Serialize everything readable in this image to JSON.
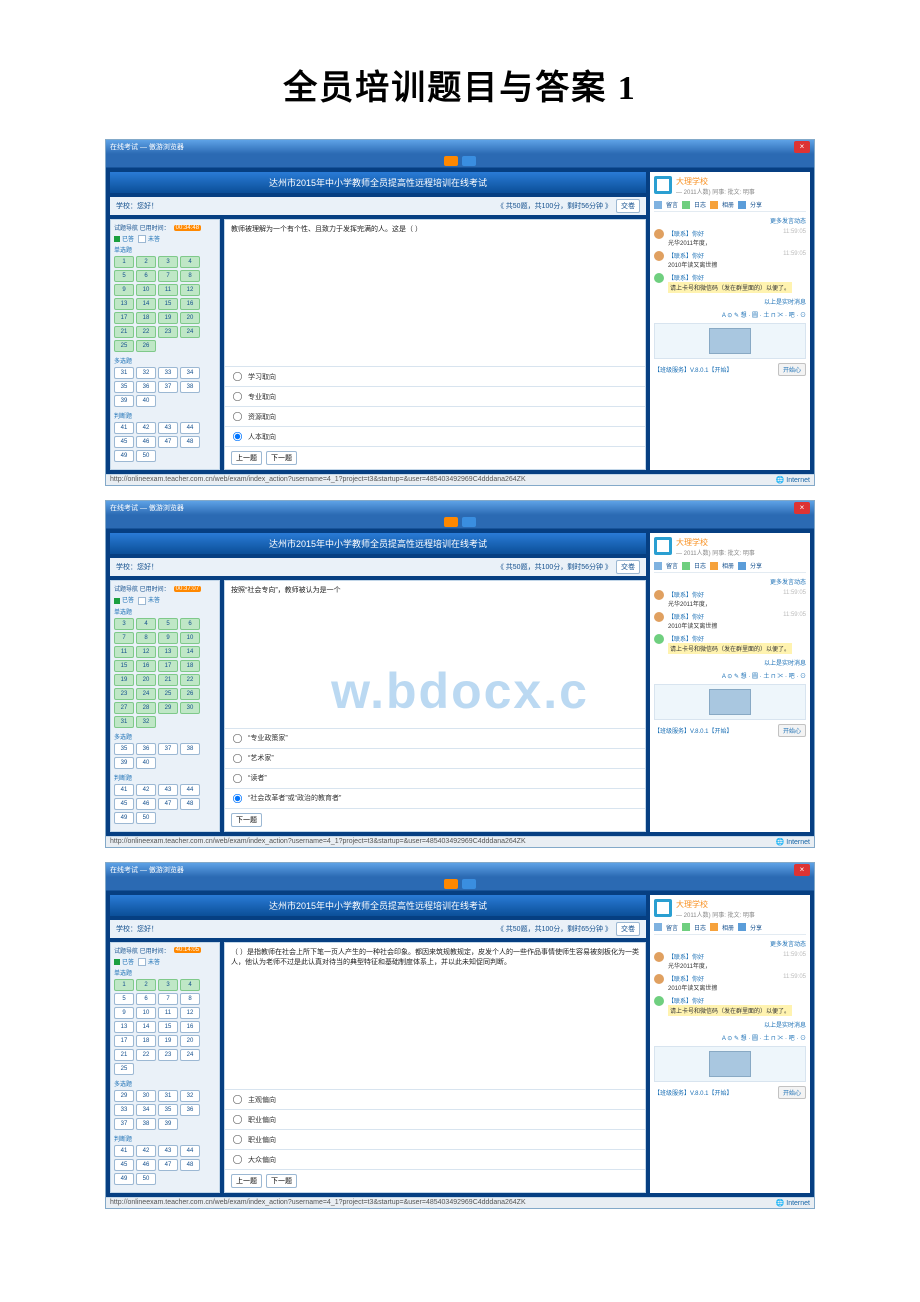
{
  "doc_title": "全员培训题目与答案 1",
  "watermark": "w.bdocx.c",
  "browser": {
    "title_prefix": "在线考试 — 傲游浏览器",
    "close": "×"
  },
  "statusbar": {
    "url": "http://onlineexam.teacher.com.cn/web/exam/index_action?username=4_1?project=t3&startup=&user=485403492969C4dddana264ZK",
    "inet": "Internet"
  },
  "right": {
    "school_name": "大理学校",
    "school_sub": "— 2011人数) 同事: 批文: 明事",
    "tabs": [
      "留言",
      "日志",
      "相册",
      "分享"
    ],
    "more_link": "更多发言动态",
    "feed": [
      {
        "user": "【联系】你好",
        "time": "11:59:05",
        "msg": "光华2011年度，"
      },
      {
        "user": "【联系】你好",
        "time": "11:59:05",
        "msg": "2010年读又离世擦"
      },
      {
        "user": "【联系】你好",
        "time": "",
        "msg_hl": "请上卡号和微信码（发在群里面的）以便了。"
      }
    ],
    "feed_more": "以上是实时消息",
    "footer_left": "【班级服务】V.8.0.1【开始】",
    "footer_btn": "开始心"
  },
  "shots": [
    {
      "banner": "达州市2015年中小学教师全员提高性远程培训在线考试",
      "toolbar_left": "学校：您好！",
      "toolbar_mid": "《 共50题，共100分，剩时56分钟 》",
      "toolbar_btn": "交卷",
      "nav": {
        "label": "试题导航   已用时间：",
        "timer": "00:34:48",
        "legend_done": "已答",
        "legend_todo": "未答",
        "sections": [
          {
            "title": "单选题",
            "from": 1,
            "to": 26,
            "done_to": 26
          },
          {
            "title": "多选题",
            "from": 31,
            "to": 40,
            "done_to": 0
          },
          {
            "title": "判断题",
            "from": 41,
            "to": 50,
            "done_to": 0
          }
        ]
      },
      "question": "教师被理解为一个有个性、且致力于发挥完满的人。这是（ ）",
      "options": [
        "学习取向",
        "专业取向",
        "资源取向",
        "人本取向"
      ],
      "selected": 3,
      "prev": "上一题",
      "next": "下一题"
    },
    {
      "banner": "达州市2015年中小学教师全员提高性远程培训在线考试",
      "toolbar_left": "学校：您好！",
      "toolbar_mid": "《 共50题，共100分，剩时56分钟 》",
      "toolbar_btn": "交卷",
      "nav": {
        "label": "试题导航   已用时间：",
        "timer": "00:37:07",
        "legend_done": "已答",
        "legend_todo": "未答",
        "sections": [
          {
            "title": "单选题",
            "from": 3,
            "to": 32,
            "done_to": 32
          },
          {
            "title": "多选题",
            "from": 35,
            "to": 40,
            "done_to": 0
          },
          {
            "title": "判断题",
            "from": 41,
            "to": 50,
            "done_to": 0
          }
        ]
      },
      "question": "按照“社会专向”，教师被认为是一个",
      "options": [
        "“专业政策家”",
        "“艺术家”",
        "“读者”",
        "“社会改革者”或“政治的教育者”"
      ],
      "selected": 3,
      "next": "下一题"
    },
    {
      "banner": "达州市2015年中小学教师全员提高性远程培训在线考试",
      "toolbar_left": "学校：您好！",
      "toolbar_mid": "《 共50题，共100分，剩时65分钟 》",
      "toolbar_btn": "交卷",
      "nav": {
        "label": "试题导航   已用时间：",
        "timer": "40:14:05",
        "legend_done": "已答",
        "legend_todo": "未答",
        "sections": [
          {
            "title": "单选题",
            "from": 1,
            "to": 25,
            "done_to": 4
          },
          {
            "title": "多选题",
            "from": 29,
            "to": 39,
            "done_to": 0
          },
          {
            "title": "判断题",
            "from": 41,
            "to": 50,
            "done_to": 0
          }
        ]
      },
      "question": "（ ）是指教师在社会上所下笔一页人产生的一种社会印象。都因来筑规教规定，皮发个人的一些作品事情使师生容易被刻板化为一类人，他认为老师不过是此认真对待当的典型特征和基础制度体系上，并以此未知促同判断。",
      "options": [
        "主观偏向",
        "职业偏向",
        "职业偏向",
        "大众偏向"
      ],
      "selected": -1,
      "prev": "上一题",
      "next": "下一题"
    }
  ]
}
